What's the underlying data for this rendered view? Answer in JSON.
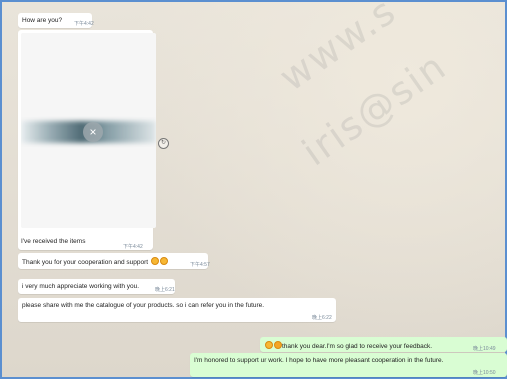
{
  "watermark": {
    "line1": "www.s",
    "line2": "iris@sin"
  },
  "messages": [
    {
      "id": "m1",
      "dir": "in",
      "text": "How are you?",
      "time": "下午4:42"
    },
    {
      "id": "m2",
      "dir": "in",
      "caption": "I've received the items",
      "time": "下午4:42",
      "media": true
    },
    {
      "id": "m3",
      "dir": "in",
      "text": "Thank you for your cooperation and support",
      "emoji": [
        "smile",
        "smile"
      ],
      "time": "下午4:57"
    },
    {
      "id": "m4",
      "dir": "in",
      "text": "i very much appreciate working with you.",
      "time": "晚上6:21"
    },
    {
      "id": "m5",
      "dir": "in",
      "text": "please share with me the catalogue of your products. so i can refer you in the future.",
      "time": "晚上6:22"
    },
    {
      "id": "m6",
      "dir": "out",
      "emoji": [
        "smile",
        "heart-eyes"
      ],
      "text": "thank you dear.I'm so glad to receive your feedback.",
      "time": "晚上10:49"
    },
    {
      "id": "m7",
      "dir": "out",
      "text": "I'm honored to support ur work. I hope to have more pleasant cooperation in the future.",
      "time": "晚上10:50"
    }
  ],
  "icons": {
    "close": "close-icon",
    "forward": "forward-icon",
    "emoji": "smiley-emoji-icon"
  }
}
